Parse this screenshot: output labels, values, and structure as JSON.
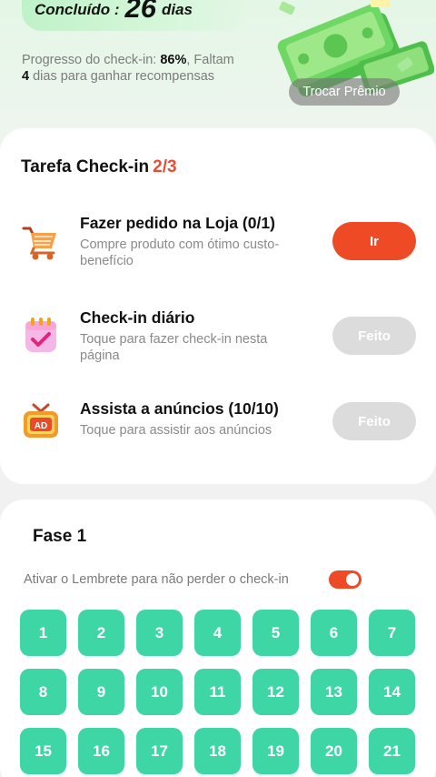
{
  "header": {
    "completed_label": "Concluído :",
    "completed_days": "26",
    "completed_unit": "dias",
    "progress_label": "Progresso do check-in: ",
    "progress_value": "86%",
    "remaining_prefix": "Faltam ",
    "remaining_days": "4",
    "remaining_suffix": " dias para ganhar recompensas",
    "redeem_label": "Trocar Prêmio"
  },
  "tasks": {
    "title": "Tarefa Check-in",
    "count": "2/3",
    "items": [
      {
        "name": "Fazer pedido na Loja  (0/1)",
        "desc": "Compre produto com ótimo custo-benefício",
        "button": "Ir",
        "icon": "shopping-cart-icon"
      },
      {
        "name": "Check-in diário",
        "desc": "Toque para fazer check-in nesta página",
        "button": "Feito",
        "icon": "calendar-check-icon"
      },
      {
        "name": "Assista a anúncios  (10/10)",
        "desc": "Toque para assistir aos anúncios",
        "button": "Feito",
        "icon": "tv-ad-icon"
      }
    ]
  },
  "phase": {
    "title": "Fase 1",
    "reminder": "Ativar o Lembrete para não perder o check-in",
    "reminder_on": true,
    "days": [
      "1",
      "2",
      "3",
      "4",
      "5",
      "6",
      "7",
      "8",
      "9",
      "10",
      "11",
      "12",
      "13",
      "14",
      "15",
      "16",
      "17",
      "18",
      "19",
      "20",
      "21"
    ]
  },
  "colors": {
    "accent": "#ee4a26",
    "day_tile": "#3fd6a6",
    "done_button": "#dcdcdc"
  }
}
